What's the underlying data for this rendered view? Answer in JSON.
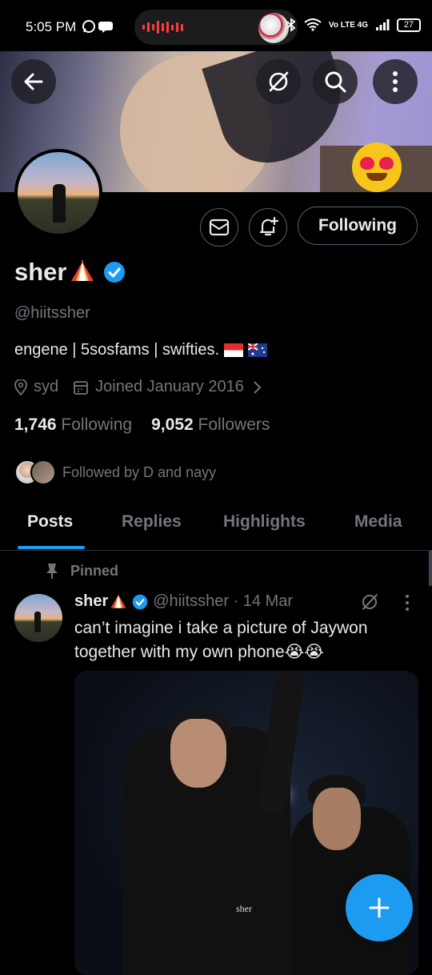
{
  "status_bar": {
    "time": "5:05 PM",
    "network": "Vo LTE 4G",
    "battery": "27"
  },
  "profile": {
    "name": "sher",
    "handle": "@hiitssher",
    "bio": "engene | 5sosfams | swifties.",
    "location": "syd",
    "joined": "Joined January 2016",
    "following_count": "1,746",
    "following_label": "Following",
    "followers_count": "9,052",
    "followers_label": "Followers",
    "followed_by": "Followed by D and nayy",
    "follow_button": "Following"
  },
  "tabs": [
    "Posts",
    "Replies",
    "Highlights",
    "Media"
  ],
  "active_tab": "Posts",
  "pinned_post": {
    "pinned_label": "Pinned",
    "author_name": "sher",
    "author_handle": "@hiitssher · 14 Mar",
    "text": "can’t imagine i take a picture of Jaywon together with my own phone😭😭",
    "image_watermark": "sher"
  },
  "colors": {
    "accent": "#1d9bf0",
    "background": "#000000",
    "secondary_text": "#71767b"
  },
  "icons": [
    "back-arrow-icon",
    "grok-icon",
    "search-icon",
    "more-vertical-icon",
    "mail-icon",
    "notification-bell-icon",
    "location-pin-icon",
    "calendar-icon",
    "chevron-right-icon",
    "pin-icon",
    "verified-badge-icon",
    "compose-plus-icon"
  ]
}
